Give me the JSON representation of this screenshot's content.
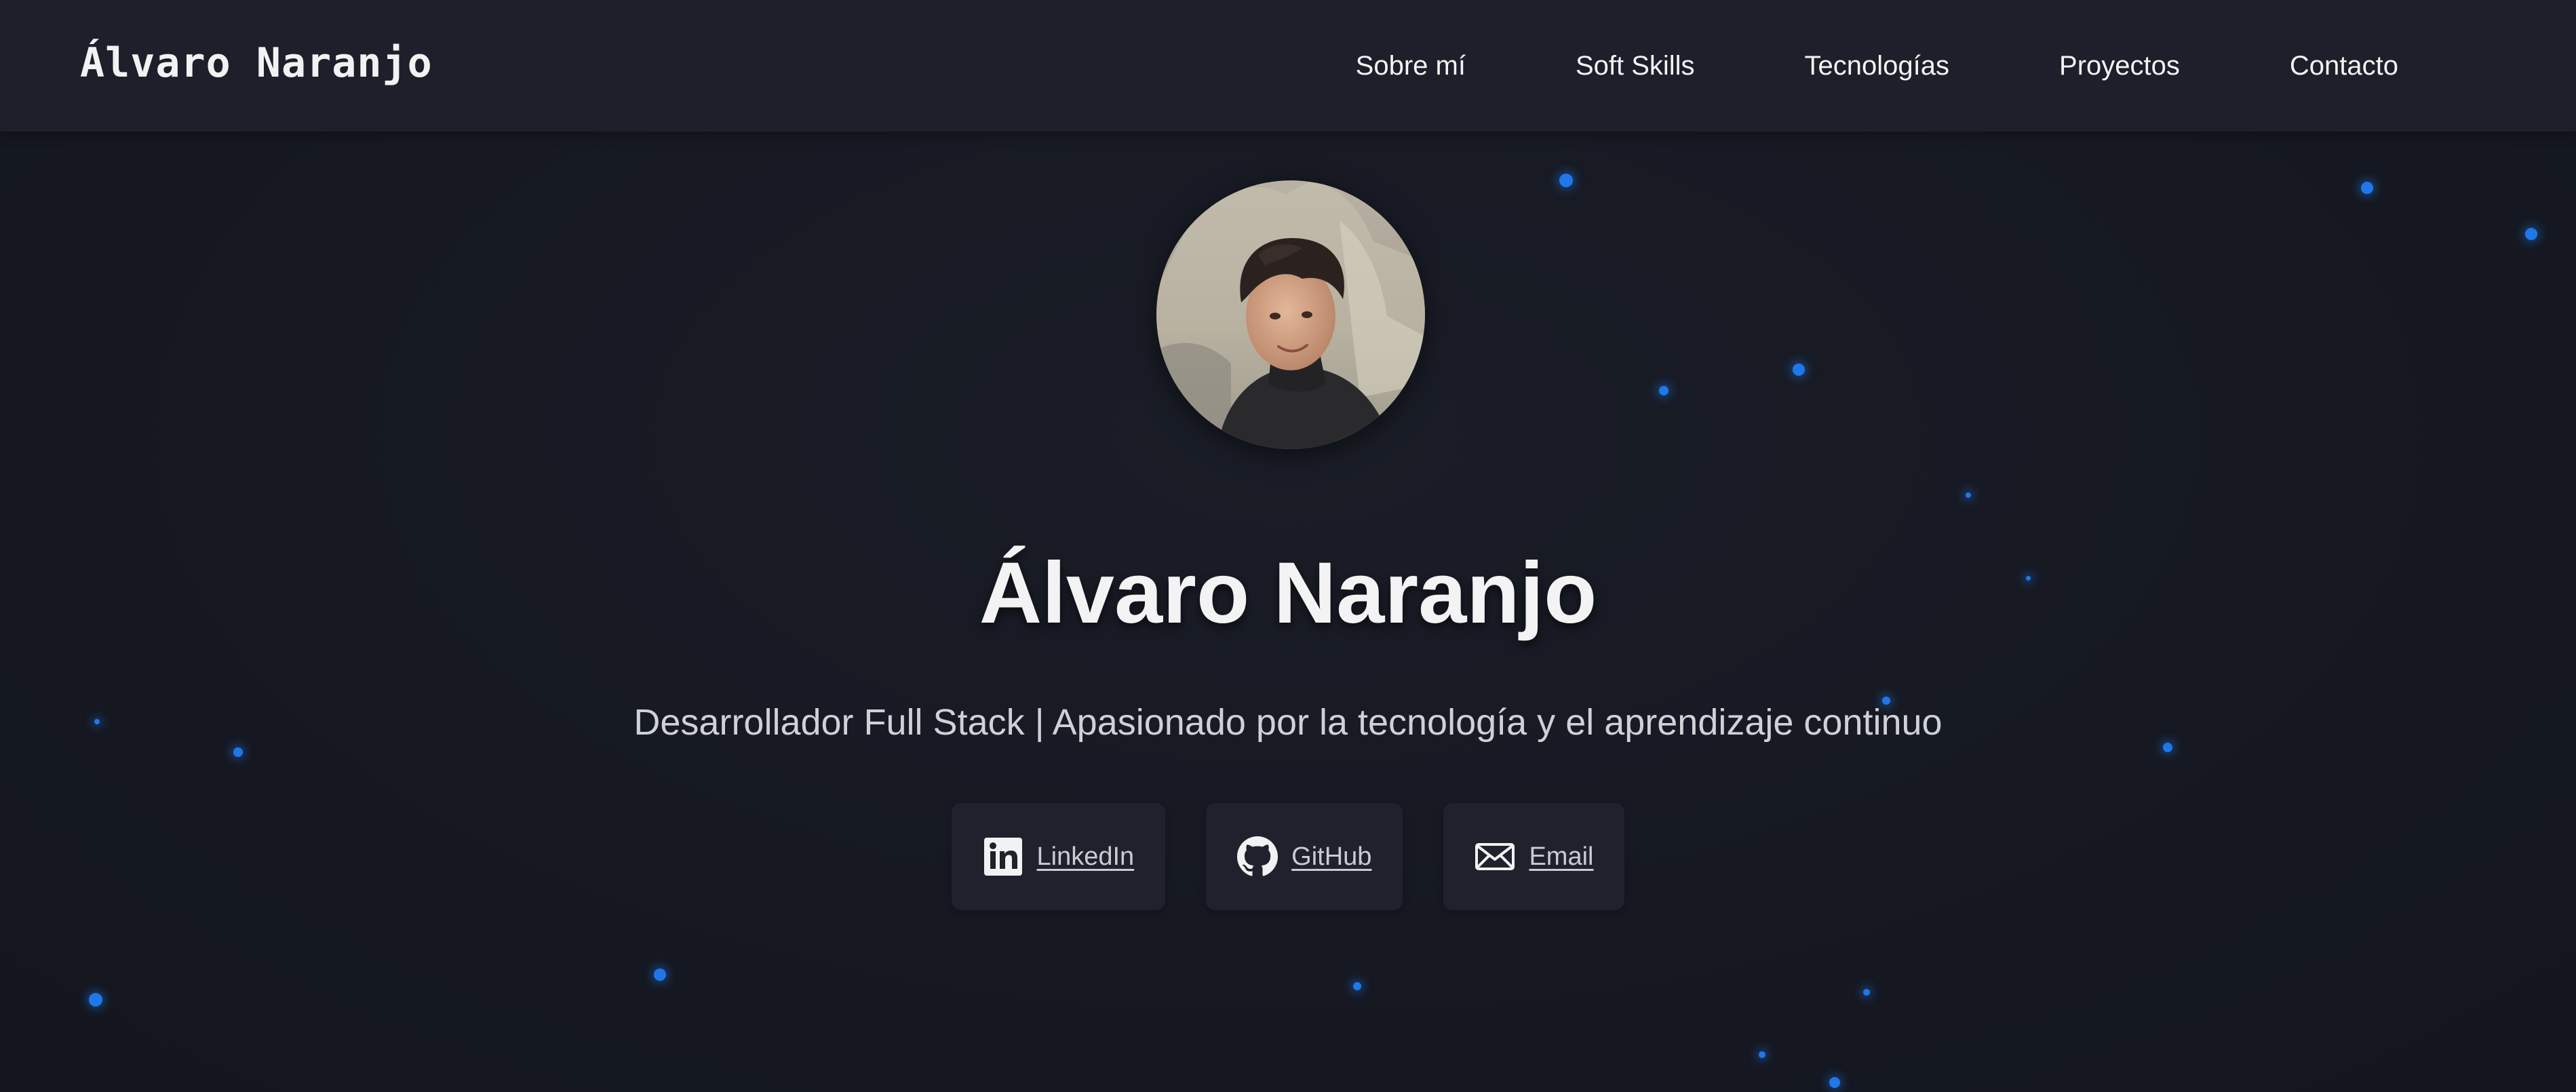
{
  "navbar": {
    "brand": "Álvaro Naranjo",
    "links": [
      {
        "label": "Sobre mí"
      },
      {
        "label": "Soft Skills"
      },
      {
        "label": "Tecnologías"
      },
      {
        "label": "Proyectos"
      },
      {
        "label": "Contacto"
      }
    ]
  },
  "hero": {
    "avatar_icon": "profile-photo",
    "title": "Álvaro Naranjo",
    "subtitle": "Desarrollador Full Stack | Apasionado por la tecnología y el aprendizaje continuo",
    "social": [
      {
        "label": "LinkedIn",
        "icon": "linkedin-icon"
      },
      {
        "label": "GitHub",
        "icon": "github-icon"
      },
      {
        "label": "Email",
        "icon": "envelope-icon"
      }
    ]
  },
  "colors": {
    "background": "#161922",
    "navbar": "#1d202b",
    "card": "#1f222c",
    "accent_particles": "#1f78ea",
    "text_primary": "#f3f3f3",
    "text_secondary": "#cfd1d6"
  }
}
